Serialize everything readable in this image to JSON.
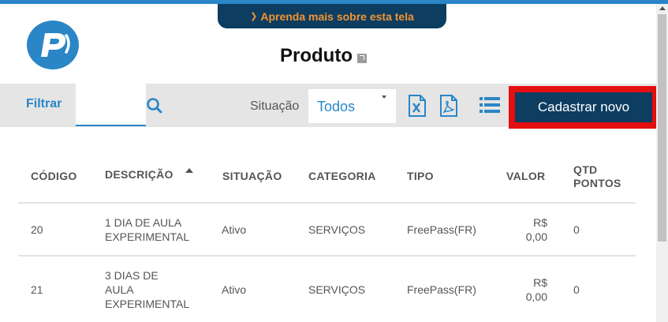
{
  "banner": {
    "learn_more": "Aprenda mais sobre esta tela"
  },
  "page": {
    "title": "Produto"
  },
  "toolbar": {
    "filter_label": "Filtrar",
    "filter_value": "",
    "status_label": "Situação",
    "status_value": "Todos",
    "new_button": "Cadastrar novo"
  },
  "table": {
    "columns": {
      "code": "CÓDIGO",
      "description": "DESCRIÇÃO",
      "status": "SITUAÇÃO",
      "category": "CATEGORIA",
      "type": "TIPO",
      "value": "VALOR",
      "points": "QTD PONTOS"
    },
    "rows": [
      {
        "code": "20",
        "description": "1 DIA DE AULA EXPERIMENTAL",
        "status": "Ativo",
        "category": "SERVIÇOS",
        "type": "FreePass(FR)",
        "value": "R$ 0,00",
        "points": "0"
      },
      {
        "code": "21",
        "description": "3 DIAS DE AULA EXPERIMENTAL",
        "status": "Ativo",
        "category": "SERVIÇOS",
        "type": "FreePass(FR)",
        "value": "R$ 0,00",
        "points": "0"
      }
    ]
  },
  "colors": {
    "accent": "#2a86c6",
    "dark": "#0d3d61",
    "orange": "#f29431",
    "highlight": "#e40f0f"
  },
  "icons": [
    "chevron-down-icon",
    "logo-icon",
    "external-link-icon",
    "search-icon",
    "excel-icon",
    "pdf-icon",
    "list-icon",
    "sort-asc-icon"
  ]
}
